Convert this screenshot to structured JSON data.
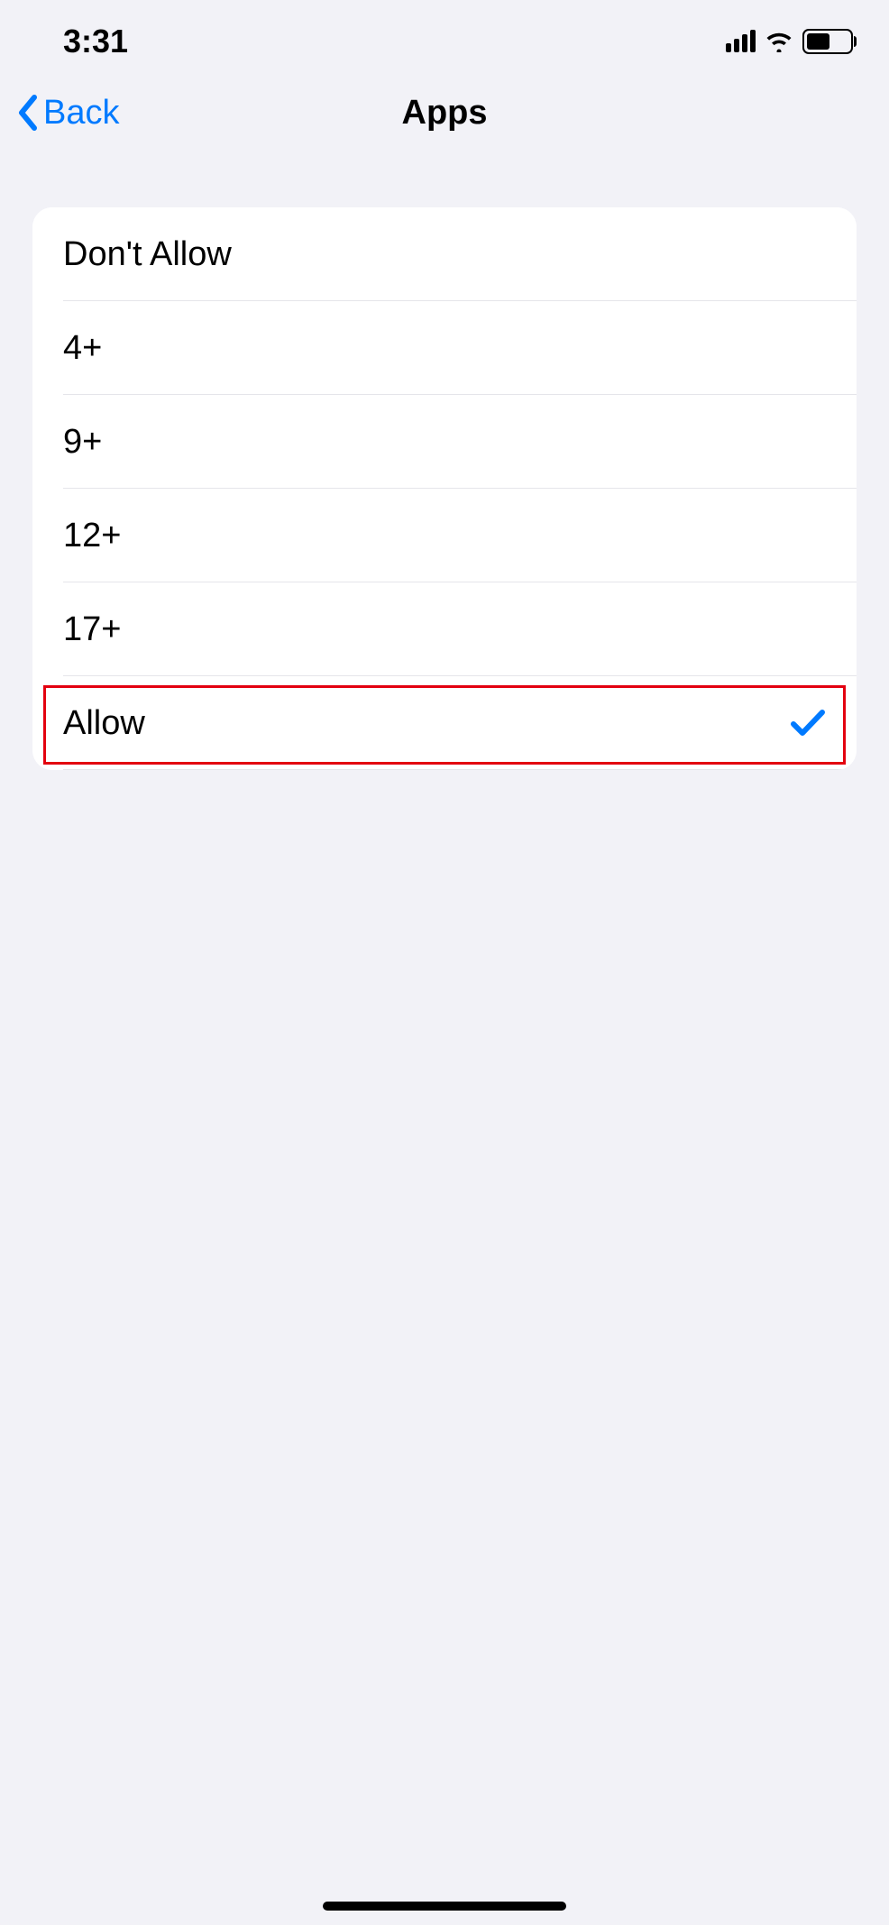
{
  "status": {
    "time": "3:31"
  },
  "nav": {
    "back_label": "Back",
    "title": "Apps"
  },
  "options": [
    {
      "label": "Don't Allow",
      "selected": false,
      "highlighted": false
    },
    {
      "label": "4+",
      "selected": false,
      "highlighted": false
    },
    {
      "label": "9+",
      "selected": false,
      "highlighted": false
    },
    {
      "label": "12+",
      "selected": false,
      "highlighted": false
    },
    {
      "label": "17+",
      "selected": false,
      "highlighted": false
    },
    {
      "label": "Allow",
      "selected": true,
      "highlighted": true
    }
  ],
  "colors": {
    "accent": "#007aff",
    "highlight": "#e3000f"
  }
}
